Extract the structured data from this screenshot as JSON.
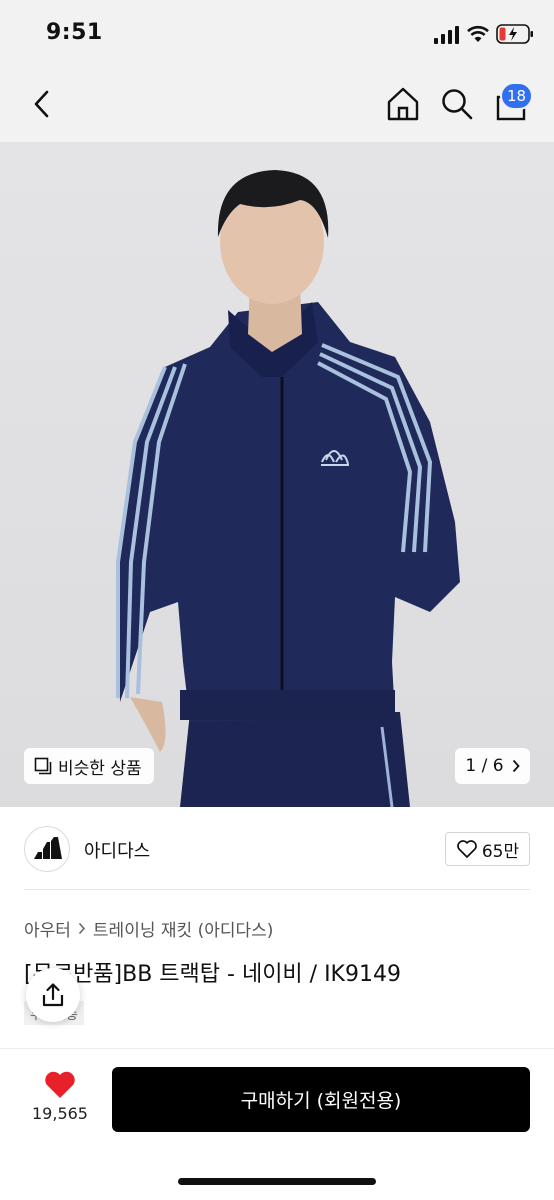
{
  "status_bar": {
    "time": "9:51"
  },
  "nav": {
    "cart_count": "18"
  },
  "gallery": {
    "similar_label": "비슷한 상품",
    "page_indicator": "1 / 6"
  },
  "brand": {
    "name": "아디다스",
    "likes": "65만"
  },
  "breadcrumb": {
    "level1": "아우터",
    "level2": "트레이닝 재킷 (아디다스)"
  },
  "product": {
    "title": "[무료반품]BB 트랙탑 - 네이비 / IK9149",
    "delivery_tag": "무료배송"
  },
  "bottom": {
    "wishlist_count": "19,565",
    "buy_label": "구매하기 (회원전용)"
  },
  "colors": {
    "accent_badge": "#2f6ff0",
    "heart": "#e8202a",
    "jacket": "#1f2a5a"
  }
}
